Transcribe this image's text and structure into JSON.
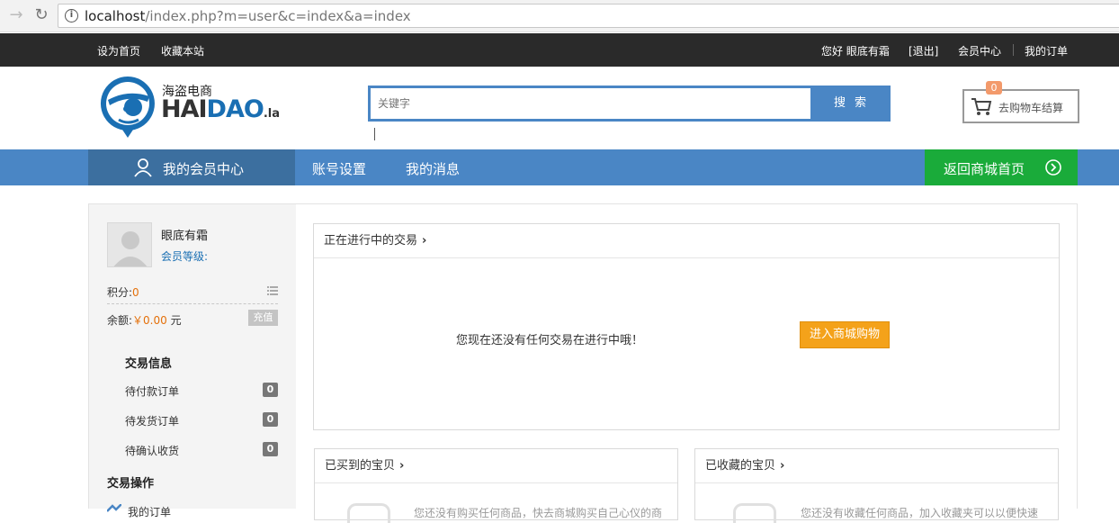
{
  "browser": {
    "url_host": "localhost",
    "url_path": "/index.php?m=user&c=index&a=index"
  },
  "topbar": {
    "set_home": "设为首页",
    "bookmark": "收藏本站",
    "greeting": "您好 眼底有霜",
    "logout": "[退出]",
    "member_center": "会员中心",
    "my_orders": "我的订单"
  },
  "header": {
    "logo_cn": "海盗电商",
    "logo_en_part1": "HAI",
    "logo_en_part2": "DAO",
    "logo_en_suffix": ".la",
    "search_placeholder": "关键字",
    "search_button": "搜索",
    "cart_label": "去购物车结算",
    "cart_count": "0"
  },
  "nav": {
    "member_center": "我的会员中心",
    "account_settings": "账号设置",
    "my_messages": "我的消息",
    "back_home": "返回商城首页"
  },
  "sidebar": {
    "username": "眼底有霜",
    "member_level": "会员等级:",
    "points_label": "积分:",
    "points_value": "0",
    "balance_label": "余额:",
    "balance_value": "￥0.00",
    "balance_unit": "元",
    "recharge": "充值",
    "trade_info_title": "交易信息",
    "items": [
      {
        "label": "待付款订单",
        "count": "0"
      },
      {
        "label": "待发货订单",
        "count": "0"
      },
      {
        "label": "待确认收货",
        "count": "0"
      }
    ],
    "trade_ops_title": "交易操作",
    "my_orders": "我的订单"
  },
  "main": {
    "ongoing_title": "正在进行中的交易",
    "ongoing_empty": "您现在还没有任何交易在进行中哦！",
    "go_shopping": "进入商城购物",
    "bought_title": "已买到的宝贝",
    "bought_empty": "您还没有购买任何商品，快去商城购买自己心仪的商",
    "fav_title": "已收藏的宝贝",
    "fav_empty": "您还没有收藏任何商品，加入收藏夹可以以便快速"
  },
  "colors": {
    "nav_blue": "#4a86c5",
    "member_dark_blue": "#3c6f9f",
    "green": "#1aab3a",
    "orange": "#f4a21a",
    "topbar": "#2a2a2a"
  }
}
